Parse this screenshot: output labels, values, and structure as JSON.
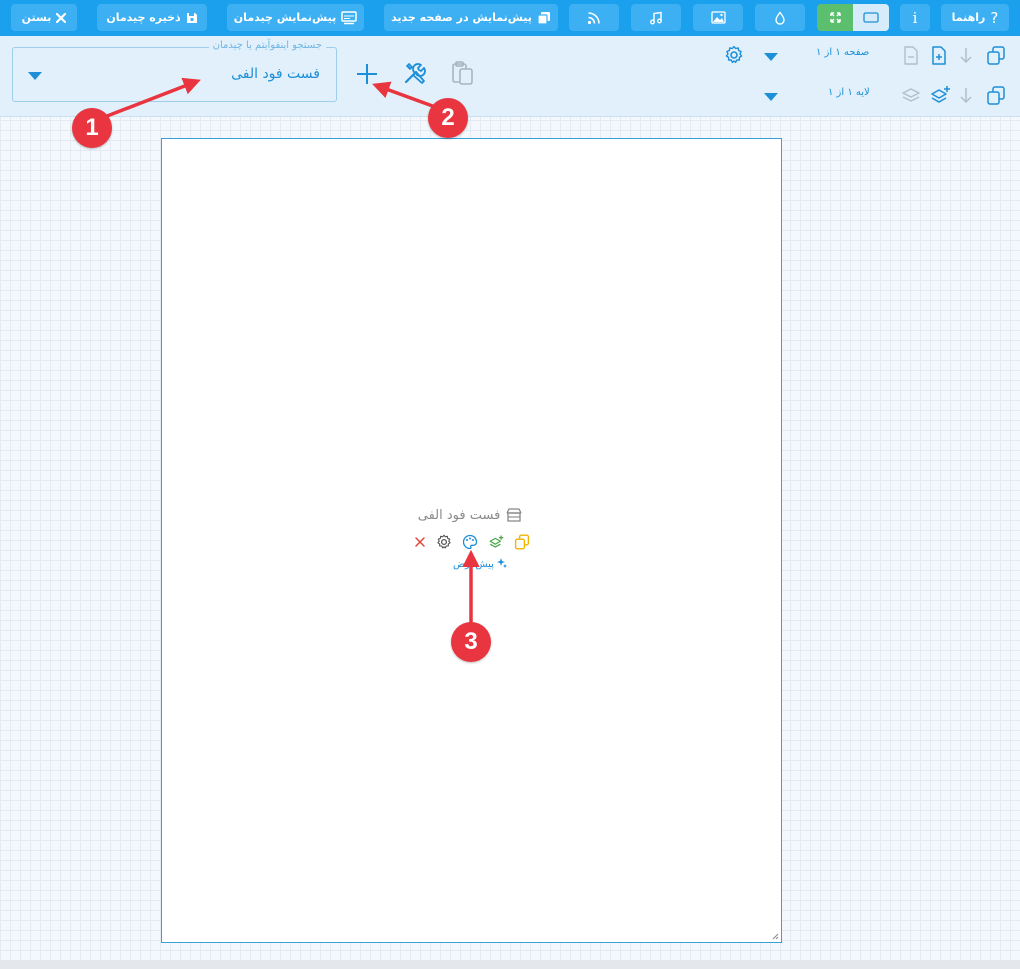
{
  "topbar": {
    "close_label": "بستن",
    "save_label": "ذخیره چیدمان",
    "preview_label": "پیش‌نمایش چیدمان",
    "preview_new_label": "پیش‌نمایش در صفحه جدید",
    "info_label": "i",
    "help_label": "راهنما",
    "help_glyph": "?"
  },
  "search": {
    "legend": "جستجو اینفوآیتم یا چیدمان",
    "value": "فست فود الفی"
  },
  "pages": {
    "label": "صفحه ۱ از ۱"
  },
  "layers": {
    "label": "لایه ۱ از ۱"
  },
  "item": {
    "title": "فست فود الفی",
    "default_label": "پیش‌فرض"
  },
  "annotations": [
    "1",
    "2",
    "3"
  ],
  "colors": {
    "topbar": "#1aa0ec",
    "toolbar": "#e1f0fb",
    "accent": "#1c8fd8",
    "annotation": "#e8353f",
    "green": "#5cbf6e"
  }
}
